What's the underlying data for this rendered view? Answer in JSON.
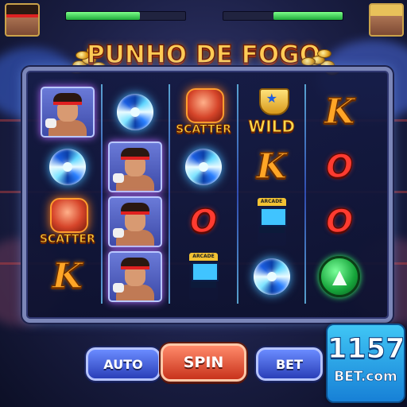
{
  "game": {
    "title": "PUNHO DE FOGO"
  },
  "hud": {
    "left_health": 0.62,
    "right_health": 0.58
  },
  "reels": [
    [
      "fighter",
      "vortex",
      "scatter",
      "K"
    ],
    [
      "vortex",
      "fighter",
      "fighter",
      "fighter"
    ],
    [
      "scatter",
      "vortex",
      "O",
      "arcade"
    ],
    [
      "wild",
      "K",
      "arcade",
      "vortex"
    ],
    [
      "K",
      "O",
      "O",
      "arrow-up"
    ]
  ],
  "symbol_labels": {
    "scatter": "SCATTER",
    "wild": "WILD",
    "K": "K",
    "O": "O",
    "arcade": "ARCADE"
  },
  "controls": {
    "auto_label": "AUTO",
    "spin_label": "SPIN",
    "bet_label": "BET"
  },
  "brand": {
    "number": "1157",
    "name": "BET.com"
  },
  "colors": {
    "accent": "#ffcc55",
    "spin": "#e0482c",
    "secondary_buttons": "#3f5ad8"
  }
}
